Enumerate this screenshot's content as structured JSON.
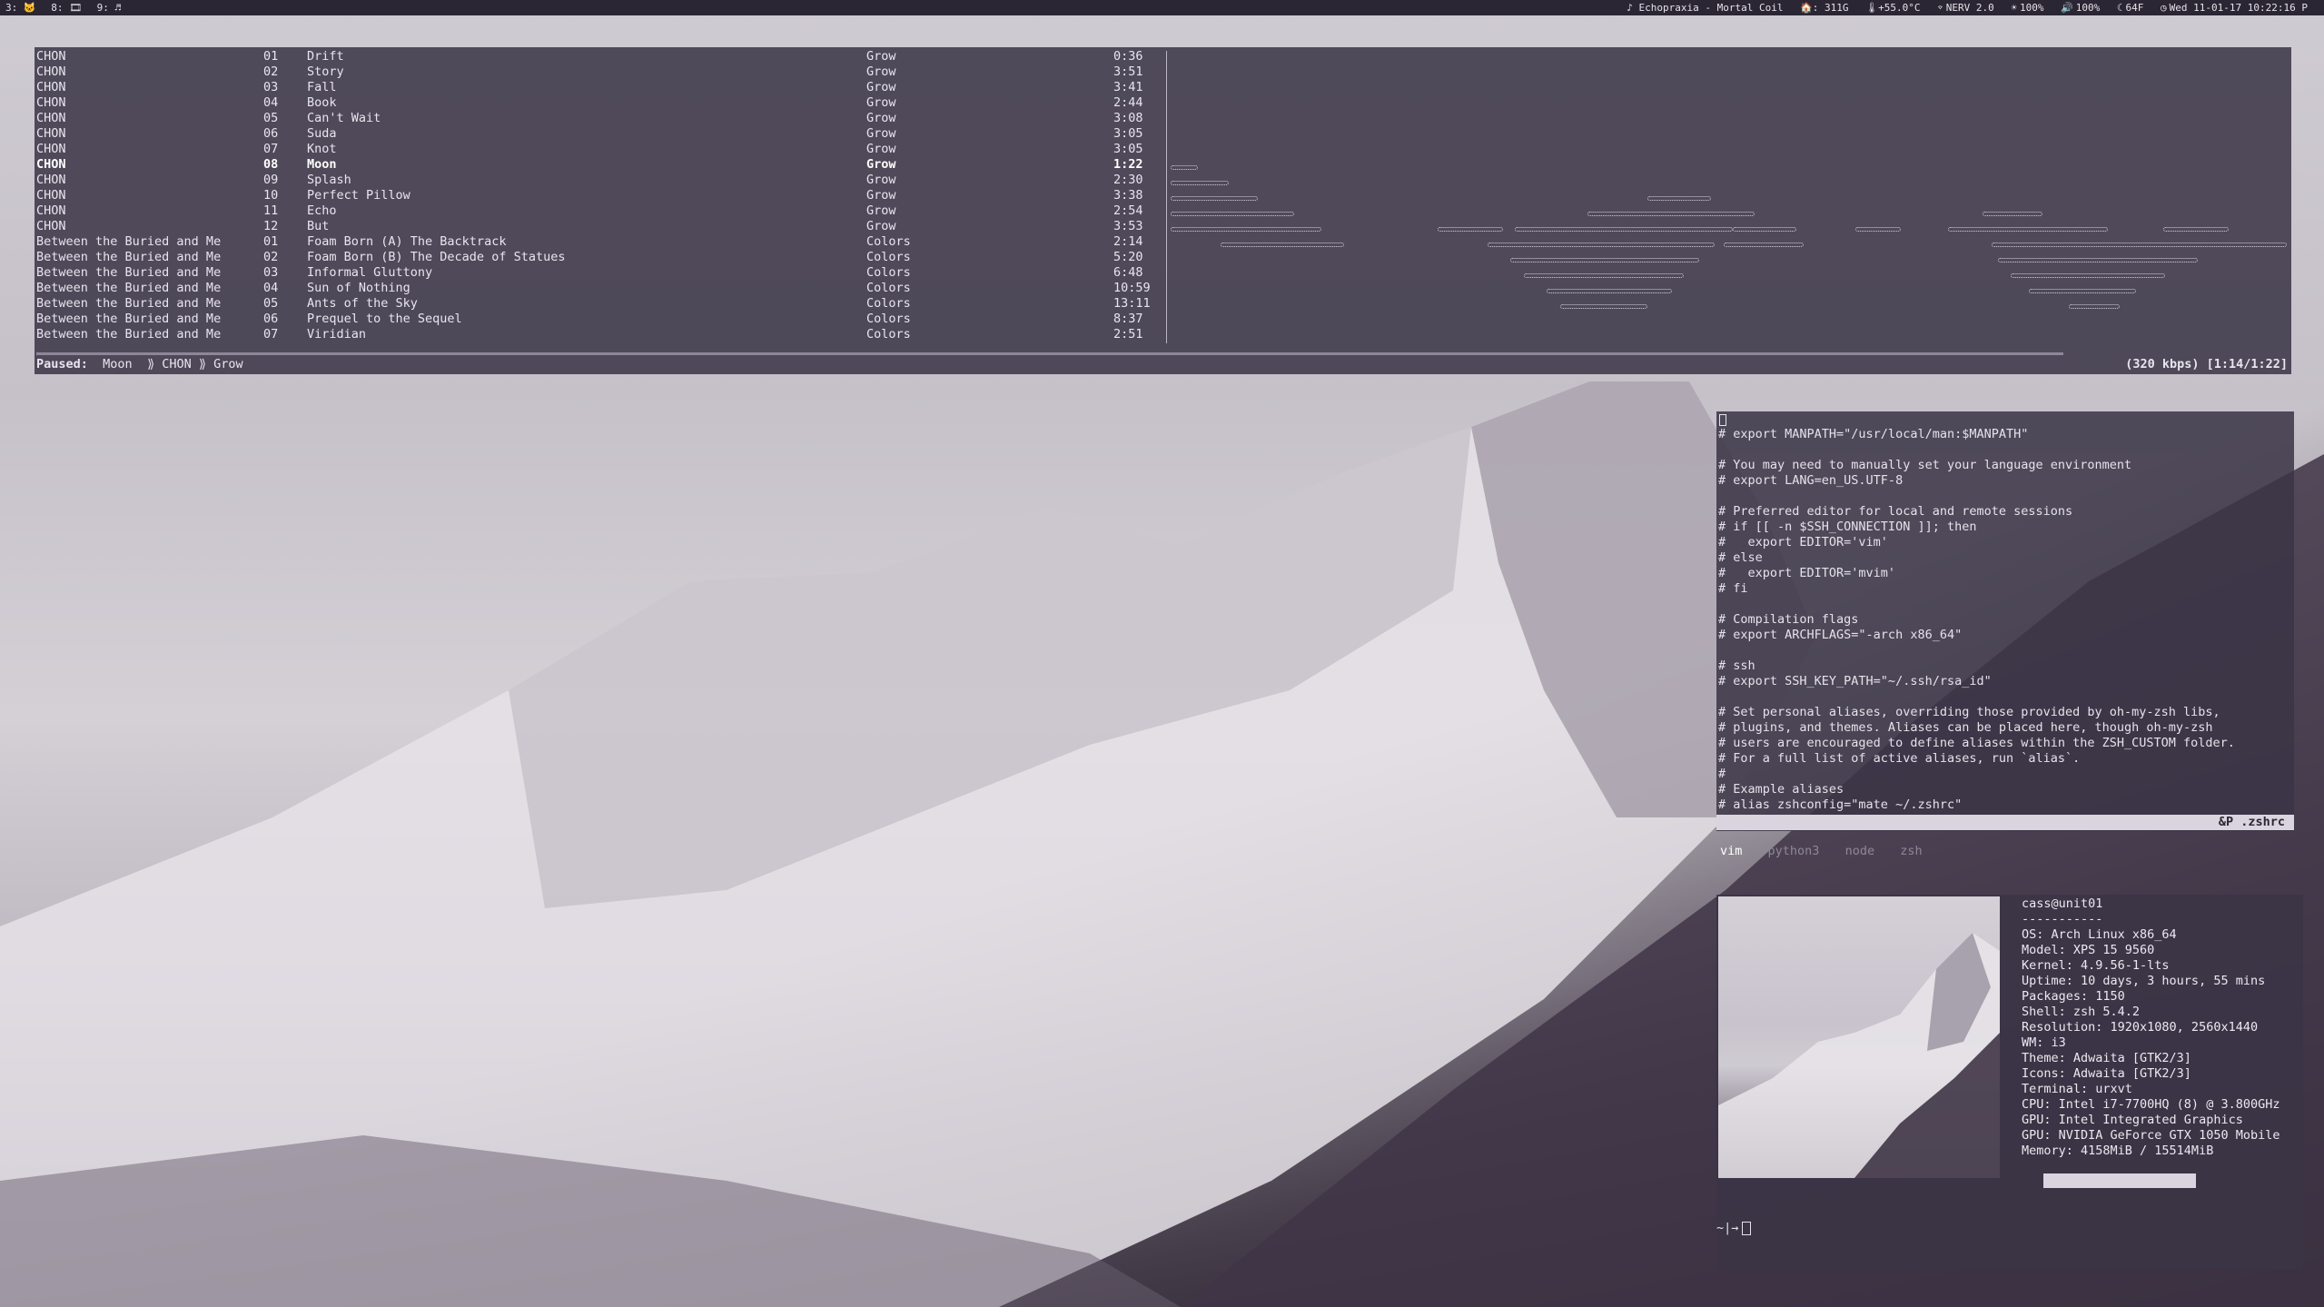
{
  "topbar": {
    "workspaces": [
      "3: 🐱",
      "8: 🎞",
      "9: ♬"
    ],
    "now_playing": "♪ Echopraxia - Mortal Coil",
    "disk": "🏠: 311G",
    "cpu_temp": "🌡+55.0°C",
    "wifi": "NERV 2.0",
    "brightness": "100%",
    "volume": "100%",
    "weather": "64F",
    "datetime": "Wed 11-01-17 10:22:16 P"
  },
  "music": {
    "tracks": [
      {
        "artist": "CHON",
        "num": "01",
        "title": "Drift",
        "album": "Grow",
        "time": "0:36"
      },
      {
        "artist": "CHON",
        "num": "02",
        "title": "Story",
        "album": "Grow",
        "time": "3:51"
      },
      {
        "artist": "CHON",
        "num": "03",
        "title": "Fall",
        "album": "Grow",
        "time": "3:41"
      },
      {
        "artist": "CHON",
        "num": "04",
        "title": "Book",
        "album": "Grow",
        "time": "2:44"
      },
      {
        "artist": "CHON",
        "num": "05",
        "title": "Can't Wait",
        "album": "Grow",
        "time": "3:08"
      },
      {
        "artist": "CHON",
        "num": "06",
        "title": "Suda",
        "album": "Grow",
        "time": "3:05"
      },
      {
        "artist": "CHON",
        "num": "07",
        "title": "Knot",
        "album": "Grow",
        "time": "3:05"
      },
      {
        "artist": "CHON",
        "num": "08",
        "title": "Moon",
        "album": "Grow",
        "time": "1:22"
      },
      {
        "artist": "CHON",
        "num": "09",
        "title": "Splash",
        "album": "Grow",
        "time": "2:30"
      },
      {
        "artist": "CHON",
        "num": "10",
        "title": "Perfect Pillow",
        "album": "Grow",
        "time": "3:38"
      },
      {
        "artist": "CHON",
        "num": "11",
        "title": "Echo",
        "album": "Grow",
        "time": "2:54"
      },
      {
        "artist": "CHON",
        "num": "12",
        "title": "But",
        "album": "Grow",
        "time": "3:53"
      },
      {
        "artist": "Between the Buried and Me",
        "num": "01",
        "title": "Foam Born (A) The Backtrack",
        "album": "Colors",
        "time": "2:14"
      },
      {
        "artist": "Between the Buried and Me",
        "num": "02",
        "title": "Foam Born (B) The Decade of Statues",
        "album": "Colors",
        "time": "5:20"
      },
      {
        "artist": "Between the Buried and Me",
        "num": "03",
        "title": "Informal Gluttony",
        "album": "Colors",
        "time": "6:48"
      },
      {
        "artist": "Between the Buried and Me",
        "num": "04",
        "title": "Sun of Nothing",
        "album": "Colors",
        "time": "10:59"
      },
      {
        "artist": "Between the Buried and Me",
        "num": "05",
        "title": "Ants of the Sky",
        "album": "Colors",
        "time": "13:11"
      },
      {
        "artist": "Between the Buried and Me",
        "num": "06",
        "title": "Prequel to the Sequel",
        "album": "Colors",
        "time": "8:37"
      },
      {
        "artist": "Between the Buried and Me",
        "num": "07",
        "title": "Viridian",
        "album": "Colors",
        "time": "2:51"
      }
    ],
    "active_index": 7,
    "status": {
      "state": "Paused:",
      "track": "Moon",
      "sep": "⟫",
      "artist": "CHON",
      "album": "Grow",
      "bitrate_time": "(320 kbps) [1:14/1:22]"
    },
    "progress_fraction": 0.9
  },
  "vim": {
    "lines": [
      "# export MANPATH=\"/usr/local/man:$MANPATH\"",
      "",
      "# You may need to manually set your language environment",
      "# export LANG=en_US.UTF-8",
      "",
      "# Preferred editor for local and remote sessions",
      "# if [[ -n $SSH_CONNECTION ]]; then",
      "#   export EDITOR='vim'",
      "# else",
      "#   export EDITOR='mvim'",
      "# fi",
      "",
      "# Compilation flags",
      "# export ARCHFLAGS=\"-arch x86_64\"",
      "",
      "# ssh",
      "# export SSH_KEY_PATH=\"~/.ssh/rsa_id\"",
      "",
      "# Set personal aliases, overriding those provided by oh-my-zsh libs,",
      "# plugins, and themes. Aliases can be placed here, though oh-my-zsh",
      "# users are encouraged to define aliases within the ZSH_CUSTOM folder.",
      "# For a full list of active aliases, run `alias`.",
      "#",
      "# Example aliases",
      "# alias zshconfig=\"mate ~/.zshrc\""
    ],
    "status": "&P .zshrc",
    "tabs": [
      "vim",
      "python3",
      "node",
      "zsh"
    ],
    "active_tab": 0
  },
  "neofetch": {
    "title": "cass@unit01",
    "divider": "-----------",
    "info": [
      "OS: Arch Linux x86_64",
      "Model: XPS 15 9560",
      "Kernel: 4.9.56-1-lts",
      "Uptime: 10 days, 3 hours, 55 mins",
      "Packages: 1150",
      "Shell: zsh 5.4.2",
      "Resolution: 1920x1080, 2560x1440",
      "WM: i3",
      "Theme: Adwaita [GTK2/3]",
      "Icons: Adwaita [GTK2/3]",
      "Terminal: urxvt",
      "CPU: Intel i7-7700HQ (8) @ 3.800GHz",
      "GPU: Intel Integrated Graphics",
      "GPU: NVIDIA GeForce GTX 1050 Mobile",
      "Memory: 4158MiB / 15514MiB"
    ],
    "prompt": "~|→"
  }
}
